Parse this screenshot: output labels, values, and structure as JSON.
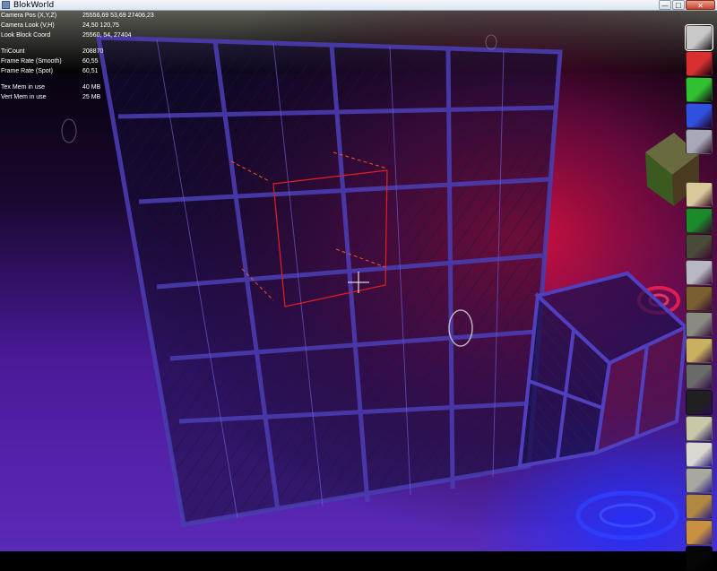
{
  "window": {
    "title": "BlokWorld",
    "minimize_label": "—",
    "maximize_label": "☐",
    "close_label": "✕"
  },
  "hud": {
    "rows": [
      {
        "label": "Camera Pos (X,Y,Z)",
        "value": "25556,69   53,69   27406,23"
      },
      {
        "label": "Camera Look (V,H)",
        "value": "24,50   120,75"
      },
      {
        "label": "Look Block Coord",
        "value": "25560, 54, 27404"
      },
      {
        "label": "TriCount",
        "value": "208870"
      },
      {
        "label": "Frame Rate (Smooth)",
        "value": "60,55"
      },
      {
        "label": "Frame Rate (Spot)",
        "value": "60,51"
      },
      {
        "label": "Tex  Mem in use",
        "value": "40 MB"
      },
      {
        "label": "Vert Mem in use",
        "value": "25 MB"
      }
    ]
  },
  "palette": {
    "colors": [
      "#c8c8c8",
      "#d83030",
      "#30c030",
      "#3050e0",
      "#a8a8b8",
      "#d8c89a",
      "#1a8a2a",
      "#4a4a3a",
      "#b8b8c0",
      "#7a6030",
      "#8a8a80",
      "#c8b060",
      "#6a6a68",
      "#202020",
      "#c8c8a8",
      "#d8d8d0",
      "#a8a8a0",
      "#b08840",
      "#c89040",
      "#060606"
    ],
    "selected_index": 0
  }
}
